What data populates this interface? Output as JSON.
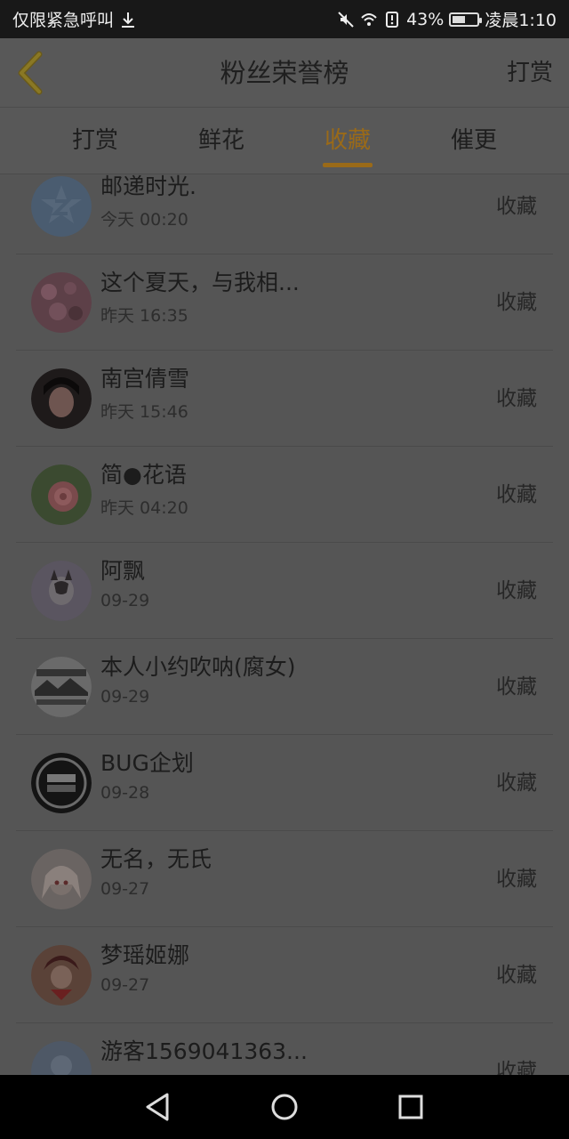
{
  "status_bar": {
    "left_text": "仅限紧急呼叫",
    "battery": "43%",
    "time": "凌晨1:10",
    "icons": [
      "download-icon",
      "mute-icon",
      "wifi-icon",
      "alert-icon",
      "battery-icon"
    ]
  },
  "header": {
    "title": "粉丝荣誉榜",
    "action_label": "打赏"
  },
  "tabs": [
    {
      "label": "打赏",
      "active": false
    },
    {
      "label": "鲜花",
      "active": false
    },
    {
      "label": "收藏",
      "active": true
    },
    {
      "label": "催更",
      "active": false
    }
  ],
  "accent_color": "#9a6a18",
  "fans": [
    {
      "name": "邮递时光.",
      "time": "今天 00:20",
      "tag": "收藏"
    },
    {
      "name": "这个夏天，与我相...",
      "time": "昨天 16:35",
      "tag": "收藏"
    },
    {
      "name": "南宫倩雪",
      "time": "昨天 15:46",
      "tag": "收藏"
    },
    {
      "name": "简●花语",
      "time": "昨天 04:20",
      "tag": "收藏"
    },
    {
      "name": "阿飘",
      "time": "09-29",
      "tag": "收藏"
    },
    {
      "name": "本人小约吹呐(腐女)",
      "time": "09-29",
      "tag": "收藏"
    },
    {
      "name": "BUG企划",
      "time": "09-28",
      "tag": "收藏"
    },
    {
      "name": "无名，无氏",
      "time": "09-27",
      "tag": "收藏"
    },
    {
      "name": "梦瑶姬娜",
      "time": "09-27",
      "tag": "收藏"
    },
    {
      "name": "游客1569041363...",
      "time": "",
      "tag": "收藏"
    }
  ],
  "nav_bar": [
    "back-icon",
    "home-icon",
    "recents-icon"
  ]
}
